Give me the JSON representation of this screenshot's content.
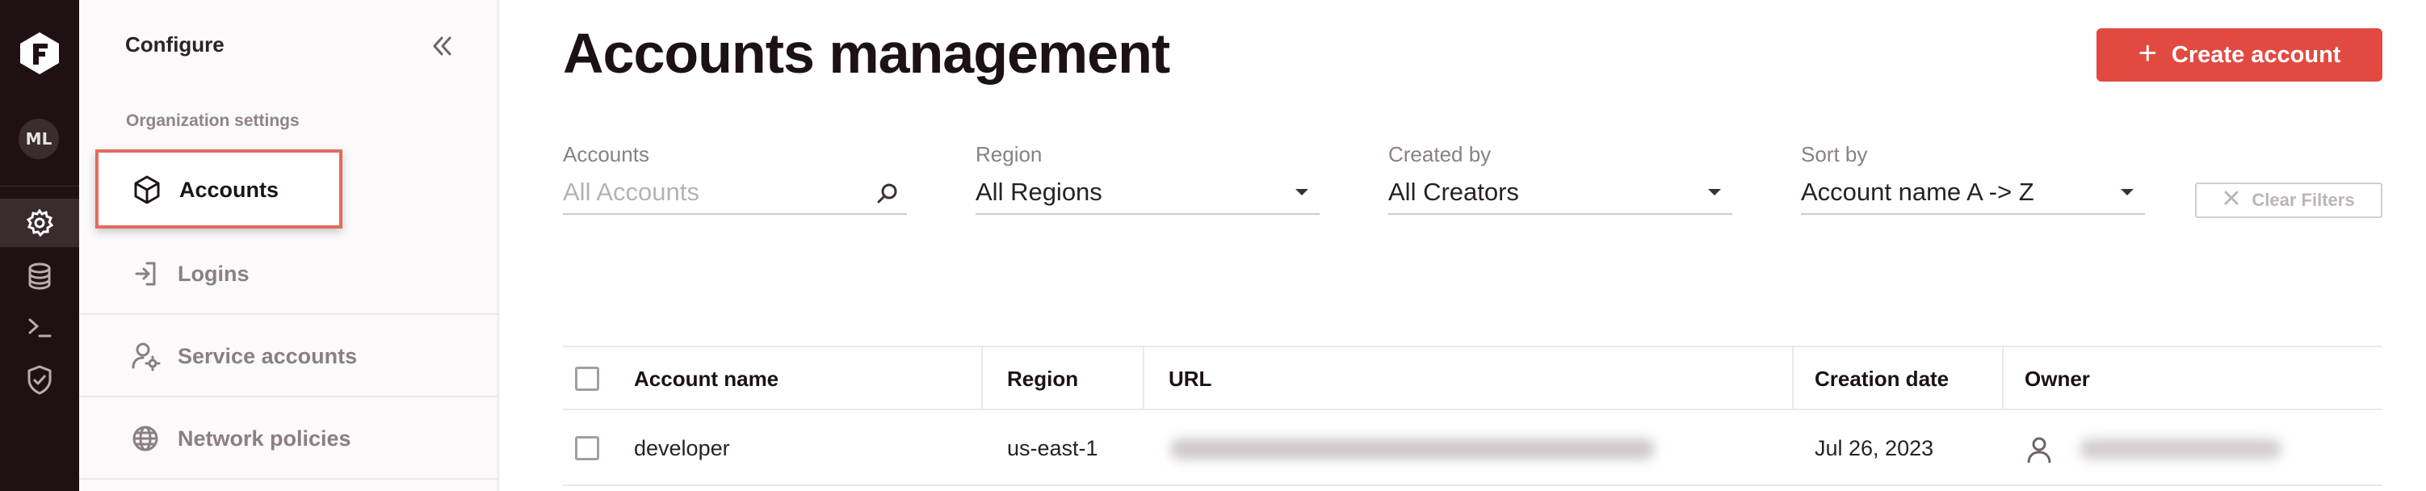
{
  "rail": {
    "logo": "F",
    "avatar": "ML",
    "icons": [
      "gear-icon",
      "database-icon",
      "terminal-icon",
      "shield-check-icon"
    ]
  },
  "sidebar": {
    "title": "Configure",
    "section": "Organization settings",
    "items": [
      {
        "label": "Accounts",
        "icon": "cube-icon",
        "active": true
      },
      {
        "label": "Logins",
        "icon": "login-icon"
      },
      {
        "label": "Service accounts",
        "icon": "user-gear-icon"
      },
      {
        "label": "Network policies",
        "icon": "globe-icon"
      }
    ]
  },
  "header": {
    "title": "Accounts management",
    "create_label": "Create account"
  },
  "filters": {
    "accounts": {
      "label": "Accounts",
      "placeholder": "All Accounts"
    },
    "region": {
      "label": "Region",
      "value": "All Regions"
    },
    "created_by": {
      "label": "Created by",
      "value": "All Creators"
    },
    "sort_by": {
      "label": "Sort by",
      "value": "Account name A -> Z"
    },
    "clear_label": "Clear Filters"
  },
  "table": {
    "columns": [
      "Account name",
      "Region",
      "URL",
      "Creation date",
      "Owner"
    ],
    "rows": [
      {
        "account_name": "developer",
        "region": "us-east-1",
        "creation_date": "Jul 26, 2023"
      }
    ]
  },
  "colors": {
    "accent": "#e24a41",
    "rail_bg": "#1e1013",
    "highlight_border": "#e16b5f"
  }
}
